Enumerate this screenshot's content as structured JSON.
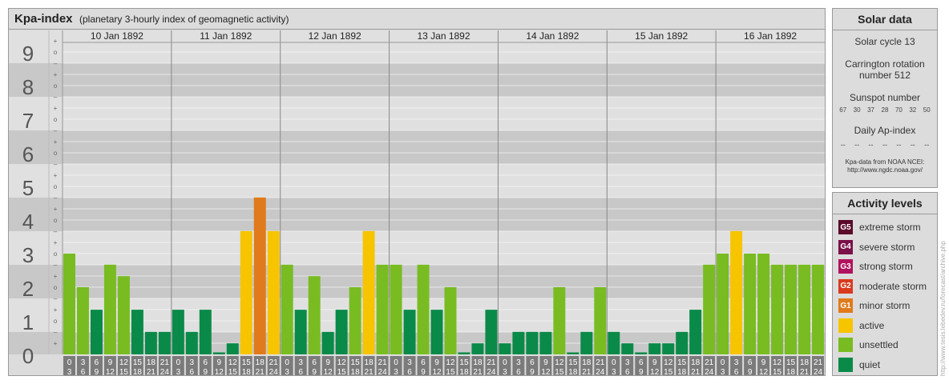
{
  "header": {
    "title": "Kpa-index",
    "subtitle": "(planetary 3-hourly index of geomagnetic activity)"
  },
  "chart_data": {
    "type": "bar",
    "ylim": [
      0,
      9
    ],
    "y_ticks": [
      "0",
      "1",
      "2",
      "3",
      "4",
      "5",
      "6",
      "7",
      "8",
      "9"
    ],
    "minor_tick_labels": [
      "+",
      "o",
      "–"
    ],
    "days": [
      "10 Jan 1892",
      "11 Jan 1892",
      "12 Jan 1892",
      "13 Jan 1892",
      "14 Jan 1892",
      "15 Jan 1892",
      "16 Jan 1892"
    ],
    "interval_labels": [
      [
        "0",
        "3"
      ],
      [
        "3",
        "6"
      ],
      [
        "6",
        "9"
      ],
      [
        "9",
        "12"
      ],
      [
        "12",
        "15"
      ],
      [
        "15",
        "18"
      ],
      [
        "18",
        "21"
      ],
      [
        "21",
        "24"
      ]
    ],
    "values": [
      3.0,
      2.0,
      1.33,
      2.67,
      2.33,
      1.33,
      0.67,
      0.67,
      1.33,
      0.67,
      1.33,
      0.0,
      0.33,
      3.67,
      4.67,
      3.67,
      2.67,
      1.33,
      2.33,
      0.67,
      1.33,
      2.0,
      3.67,
      2.67,
      2.67,
      1.33,
      2.67,
      1.33,
      2.0,
      0.0,
      0.33,
      1.33,
      0.33,
      0.67,
      0.67,
      0.67,
      2.0,
      0.0,
      0.67,
      2.0,
      0.67,
      0.33,
      0.0,
      0.33,
      0.33,
      0.67,
      1.33,
      2.67,
      3.0,
      3.67,
      3.0,
      3.0,
      2.67,
      2.67,
      2.67,
      2.67
    ],
    "colors": {
      "quiet": "#0a8a48",
      "unsettled": "#78bc22",
      "active": "#f7c400",
      "minor": "#e07a1c",
      "band_dark": "#c8c8c8",
      "band_light": "#e0e0e0",
      "label_box": "#7b7b7b"
    }
  },
  "solar": {
    "title": "Solar data",
    "cycle": "Solar cycle 13",
    "carrington_line1": "Carrington rotation",
    "carrington_line2": "number 512",
    "sunspot_title": "Sunspot number",
    "sunspots": [
      "67",
      "30",
      "37",
      "28",
      "70",
      "32",
      "50"
    ],
    "ap_title": "Daily Ap-index",
    "ap_values": [
      "--",
      "--",
      "--",
      "--",
      "--",
      "--",
      "--"
    ],
    "credit_line1": "Kpa-data from NOAA NCEI:",
    "credit_line2": "http://www.ngdc.noaa.gov/"
  },
  "legend": {
    "title": "Activity levels",
    "items": [
      {
        "code": "G5",
        "label": "extreme storm",
        "color": "#5a0a2a"
      },
      {
        "code": "G4",
        "label": "severe storm",
        "color": "#7a1048"
      },
      {
        "code": "G3",
        "label": "strong storm",
        "color": "#b0125e"
      },
      {
        "code": "G2",
        "label": "moderate storm",
        "color": "#d83a1e"
      },
      {
        "code": "G1",
        "label": "minor storm",
        "color": "#e07a1c"
      },
      {
        "code": "",
        "label": "active",
        "color": "#f7c400"
      },
      {
        "code": "",
        "label": "unsettled",
        "color": "#78bc22"
      },
      {
        "code": "",
        "label": "quiet",
        "color": "#0a8a48"
      }
    ]
  },
  "vertical_credit": "http://www.tesis.lebedev.ru/forecast/archive.php"
}
